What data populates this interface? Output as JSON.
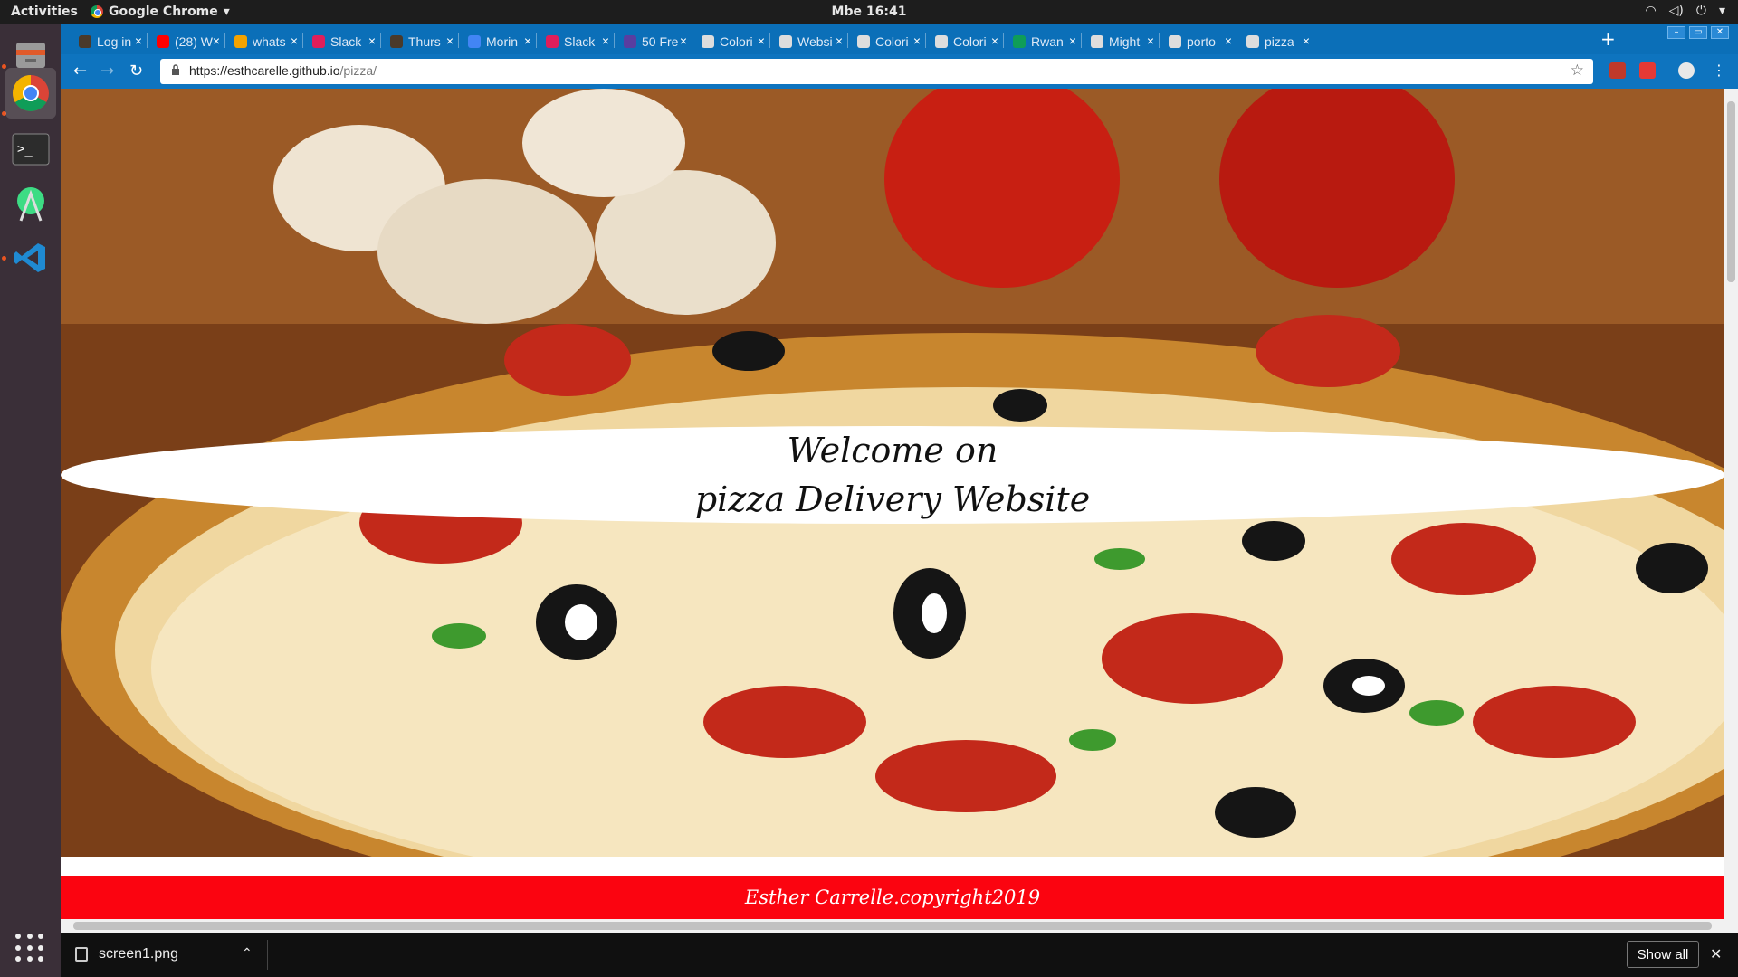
{
  "topbar": {
    "activities": "Activities",
    "app_name": "Google Chrome",
    "clock": "Mbe 16:41"
  },
  "tabs": [
    {
      "label": "Log in",
      "color": "#4a3a2a"
    },
    {
      "label": "(28) W",
      "color": "#ff0000"
    },
    {
      "label": "whats",
      "color": "#f4a300"
    },
    {
      "label": "Slack",
      "color": "#e01e5a"
    },
    {
      "label": "Thurs",
      "color": "#4a3a2a"
    },
    {
      "label": "Morin",
      "color": "#4285f4"
    },
    {
      "label": "Slack",
      "color": "#e01e5a"
    },
    {
      "label": "50 Fre",
      "color": "#5a3ea0"
    },
    {
      "label": "Colori",
      "color": "#dddddd"
    },
    {
      "label": "Websi",
      "color": "#dddddd"
    },
    {
      "label": "Colori",
      "color": "#dddddd"
    },
    {
      "label": "Colori",
      "color": "#dddddd"
    },
    {
      "label": "Rwan",
      "color": "#0f9d58"
    },
    {
      "label": "Might",
      "color": "#dddddd"
    },
    {
      "label": "porto",
      "color": "#dddddd"
    },
    {
      "label": "pizza",
      "color": "#dddddd"
    }
  ],
  "omnibox": {
    "url_host": "https://esthcarelle.github.io",
    "url_path": "/pizza/"
  },
  "page": {
    "welcome_line1": "Welcome on",
    "welcome_line2": "pizza Delivery Website",
    "footer": "Esther Carrelle.copyright2019"
  },
  "download_bar": {
    "file_name": "screen1.png",
    "show_all": "Show all"
  },
  "colors": {
    "tab_bar": "#0b6fb8",
    "footer_red": "#fb0410",
    "dock": "#3a2f38"
  }
}
